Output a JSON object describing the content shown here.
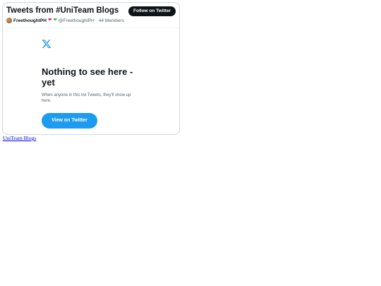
{
  "header": {
    "title": "Tweets from #UniTeam Blogs",
    "follow_label": "Follow on Twitter",
    "owner_name": "FreethoughtPH",
    "owner_handle": "@FreethoughtPH",
    "separator": "·",
    "members": "44 Members"
  },
  "empty_state": {
    "title": "Nothing to see here - yet",
    "description": "When anyone in this list Tweets, they'll show up here.",
    "button_label": "View on Twitter"
  },
  "footer": {
    "link_text": "UniTeam Blogs"
  },
  "colors": {
    "accent": "#1d9bf0",
    "follow_button": "#0f1419",
    "link": "#0000ee"
  },
  "icons": {
    "brand": "x-logo-icon",
    "hearts": [
      "red-heart-icon",
      "green-heart-icon"
    ]
  }
}
